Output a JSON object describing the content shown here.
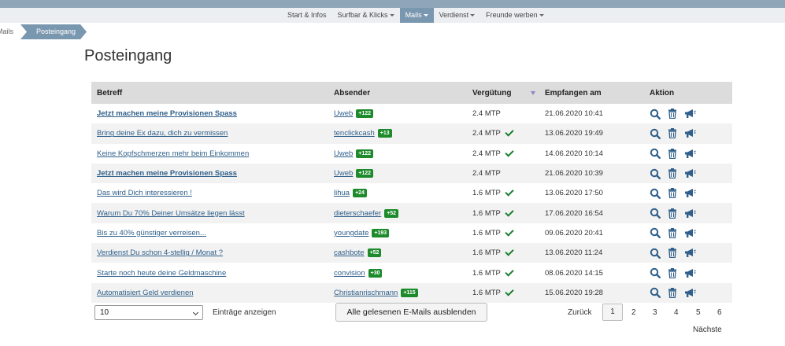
{
  "nav": {
    "items": [
      {
        "label": "Start & Infos",
        "dropdown": false,
        "active": false
      },
      {
        "label": "Surfbar & Klicks",
        "dropdown": true,
        "active": false
      },
      {
        "label": "Mails",
        "dropdown": true,
        "active": true
      },
      {
        "label": "Verdienst",
        "dropdown": true,
        "active": false
      },
      {
        "label": "Freunde werben",
        "dropdown": true,
        "active": false
      }
    ]
  },
  "breadcrumb": {
    "prev": "Mails",
    "current": "Posteingang"
  },
  "page": {
    "title": "Posteingang"
  },
  "table": {
    "headers": {
      "subject": "Betreff",
      "sender": "Absender",
      "reward": "Vergütung",
      "received": "Empfangen am",
      "action": "Aktion"
    },
    "rows": [
      {
        "subject": "Jetzt machen meine Provisionen Spass",
        "unread": true,
        "sender": "Uweb",
        "badge": "+122",
        "reward": "2.4 MTP",
        "checked": false,
        "received": "21.06.2020 10:41"
      },
      {
        "subject": "Bring deine Ex dazu, dich zu vermissen",
        "unread": false,
        "sender": "tenclickcash",
        "badge": "+13",
        "reward": "2.4 MTP",
        "checked": true,
        "received": "13.06.2020 19:49"
      },
      {
        "subject": "Keine Kopfschmerzen mehr beim Einkommen",
        "unread": false,
        "sender": "Uweb",
        "badge": "+122",
        "reward": "2.4 MTP",
        "checked": true,
        "received": "14.06.2020 10:14"
      },
      {
        "subject": "Jetzt machen meine Provisionen Spass",
        "unread": true,
        "sender": "Uweb",
        "badge": "+122",
        "reward": "2.4 MTP",
        "checked": false,
        "received": "21.06.2020 10:39"
      },
      {
        "subject": "Das wird Dich interessieren !",
        "unread": false,
        "sender": "lihua",
        "badge": "+24",
        "reward": "1.6 MTP",
        "checked": true,
        "received": "13.06.2020 17:50"
      },
      {
        "subject": "Warum Du 70% Deiner Umsätze liegen lässt",
        "unread": false,
        "sender": "dieterschaefer",
        "badge": "+52",
        "reward": "1.6 MTP",
        "checked": true,
        "received": "17.06.2020 16:54"
      },
      {
        "subject": "Bis zu 40% günstiger verreisen...",
        "unread": false,
        "sender": "youngdate",
        "badge": "+193",
        "reward": "1.6 MTP",
        "checked": true,
        "received": "09.06.2020 20:41"
      },
      {
        "subject": "Verdienst Du schon 4-stellig / Monat ?",
        "unread": false,
        "sender": "cashbote",
        "badge": "+52",
        "reward": "1.6 MTP",
        "checked": true,
        "received": "13.06.2020 11:24"
      },
      {
        "subject": "Starte noch heute deine Geldmaschine",
        "unread": false,
        "sender": "convision",
        "badge": "+30",
        "reward": "1.6 MTP",
        "checked": true,
        "received": "08.06.2020 14:15"
      },
      {
        "subject": "Automatisiert Geld verdienen",
        "unread": false,
        "sender": "Christianrischmann",
        "badge": "+115",
        "reward": "1.6 MTP",
        "checked": true,
        "received": "15.06.2020 19:28"
      }
    ]
  },
  "footer": {
    "page_size": "10",
    "entries_label": "Einträge anzeigen",
    "hide_read_label": "Alle gelesenen E-Mails ausblenden",
    "prev_label": "Zurück",
    "pages": [
      "1",
      "2",
      "3",
      "4",
      "5",
      "6"
    ],
    "current_page": "1",
    "next_label": "Nächste"
  },
  "colors": {
    "accent": "#7a97b0",
    "badge": "#1d8a2b",
    "link": "#2f5f8a",
    "icon": "#2f5f8a"
  },
  "icons": {
    "view": "magnifier-icon",
    "delete": "trash-icon",
    "report": "megaphone-icon",
    "read": "check-icon"
  }
}
